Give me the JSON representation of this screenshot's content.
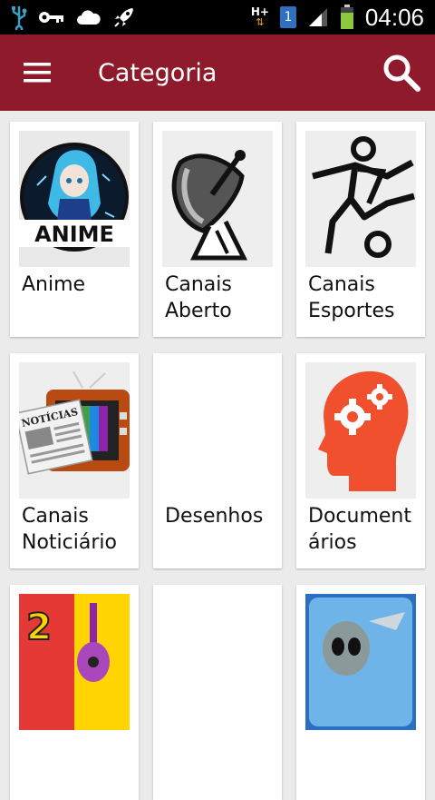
{
  "status_bar": {
    "time": "04:06",
    "network_type": "H+",
    "sim_slot": "1",
    "icons": [
      "usb-icon",
      "key-icon",
      "cloud-icon",
      "rocket-icon",
      "network-icon",
      "sim-icon",
      "signal-icon",
      "battery-icon"
    ]
  },
  "app_bar": {
    "title": "Categoria",
    "background_color": "#8e1a2b",
    "icons": [
      "menu-icon",
      "search-icon"
    ]
  },
  "categories": [
    {
      "label": "Anime",
      "thumb_text": "ANIME",
      "icon": "anime-icon"
    },
    {
      "label": "Canais Aberto",
      "icon": "satellite-dish-icon"
    },
    {
      "label": "Canais Esportes",
      "icon": "soccer-player-icon"
    },
    {
      "label": "Canais Noticiário",
      "thumb_text": "NOTÍCIAS",
      "icon": "news-tv-icon"
    },
    {
      "label": "Desenhos",
      "icon": ""
    },
    {
      "label": "Document ários",
      "icon": "head-gears-icon"
    },
    {
      "label": "",
      "thumb_text": "2",
      "icon": "guitar-number-icon"
    },
    {
      "label": "",
      "icon": ""
    },
    {
      "label": "",
      "icon": "alien-icon"
    }
  ]
}
